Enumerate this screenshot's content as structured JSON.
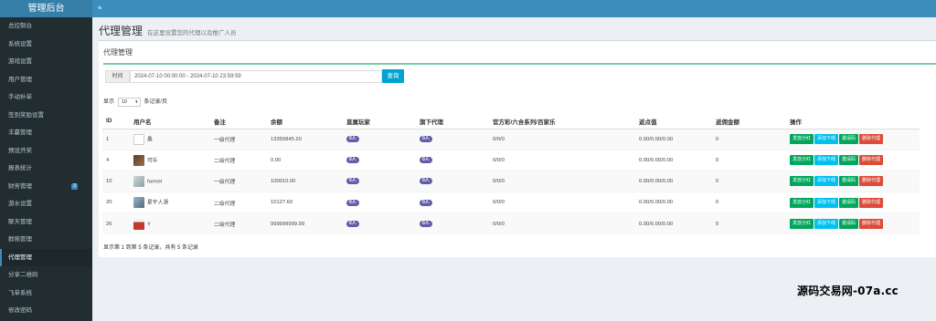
{
  "brand": "管理后台",
  "sidebar": {
    "items": [
      {
        "label": "总控制台"
      },
      {
        "label": "系统设置"
      },
      {
        "label": "游戏设置"
      },
      {
        "label": "用户管理"
      },
      {
        "label": "手动补单"
      },
      {
        "label": "签到奖励设置"
      },
      {
        "label": "丰赢管理"
      },
      {
        "label": "预设开奖"
      },
      {
        "label": "报表统计"
      },
      {
        "label": "财务管理",
        "badge": "3"
      },
      {
        "label": "游水设置"
      },
      {
        "label": "聊天管理"
      },
      {
        "label": "群拖管理"
      },
      {
        "label": "代理管理",
        "active": true
      },
      {
        "label": "分享二维码"
      },
      {
        "label": "飞单系统"
      },
      {
        "label": "修改密码"
      }
    ]
  },
  "topbar": {
    "toggle": "≡"
  },
  "header": {
    "title": "代理管理",
    "subtitle": "在这里设置您的代理以及推广人员"
  },
  "box": {
    "title": "代理管理"
  },
  "filter": {
    "label": "时间",
    "value": "2024-07-10 00:00:00 - 2024-07-10 23:59:59",
    "search_label": "查询"
  },
  "paging": {
    "show_label": "显示",
    "page_size": "10",
    "per_page_label": "条记录/页"
  },
  "table": {
    "columns": [
      "ID",
      "用户名",
      "备注",
      "余额",
      "直属玩家",
      "旗下代理",
      "官方彩/六合系列/百家乐",
      "返点值",
      "返佣金额",
      "操作"
    ],
    "rows": [
      {
        "id": "1",
        "username": "桑",
        "note": "一级代理",
        "balance": "13355845.20",
        "direct_players": "0人",
        "sub_agents": "0人",
        "rates": "0/0/0",
        "rebate": "0.00/0.00/0.00",
        "commission": "0",
        "avatar": "broken"
      },
      {
        "id": "4",
        "username": "可乐",
        "note": "二级代理",
        "balance": "0.00",
        "direct_players": "0人",
        "sub_agents": "0人",
        "rates": "0/0/0",
        "rebate": "0.00/0.00/0.00",
        "commission": "0",
        "avatar": "photo-dark"
      },
      {
        "id": "10",
        "username": "farmer",
        "note": "一级代理",
        "balance": "100010.00",
        "direct_players": "0人",
        "sub_agents": "0人",
        "rates": "0/0/0",
        "rebate": "0.00/0.00/0.00",
        "commission": "0",
        "avatar": "photo-light"
      },
      {
        "id": "20",
        "username": "星宇人源",
        "note": "二级代理",
        "balance": "10127.60",
        "direct_players": "0人",
        "sub_agents": "0人",
        "rates": "0/0/0",
        "rebate": "0.00/0.00/0.00",
        "commission": "0",
        "avatar": "photo-blue"
      },
      {
        "id": "26",
        "username": "Y",
        "note": "二级代理",
        "balance": "999999999.99",
        "direct_players": "0人",
        "sub_agents": "0人",
        "rates": "0/0/0",
        "rebate": "0.00/0.00/0.00",
        "commission": "0",
        "avatar": "photo-red"
      }
    ],
    "actions": {
      "dividend": "发放分红",
      "add_sub": "添加下线",
      "invite": "邀请码",
      "delete": "删除代理"
    }
  },
  "footer_info": "显示第 1 到第 5 条记录，共有 5 条记录",
  "watermark": "源码交易网-07a.cc",
  "colors": {
    "sidebar": "#222d32",
    "topbar": "#3c8dbc",
    "brand": "#367fa9",
    "green": "#00a65a",
    "blue": "#00c0ef",
    "red": "#dd4b39",
    "purple": "#605ca8"
  }
}
